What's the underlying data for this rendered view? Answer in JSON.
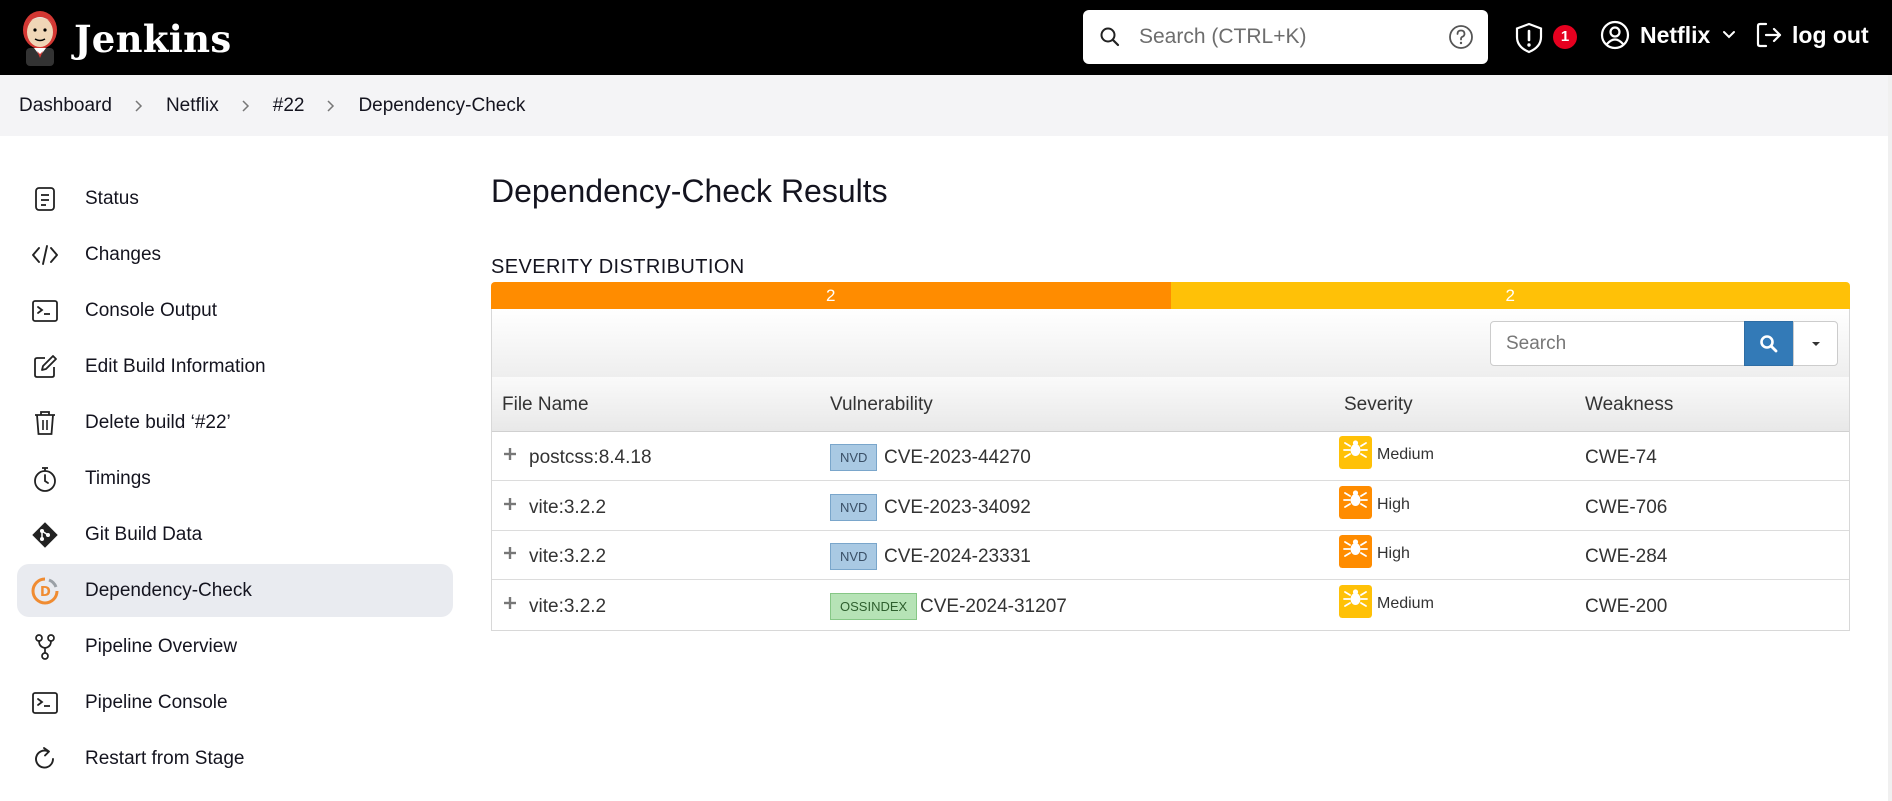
{
  "header": {
    "app_name": "Jenkins",
    "search_placeholder": "Search (CTRL+K)",
    "security_badge": "1",
    "user_name": "Netflix",
    "logout_label": "log out"
  },
  "breadcrumb": [
    "Dashboard",
    "Netflix",
    "#22",
    "Dependency-Check"
  ],
  "sidebar": {
    "items": [
      {
        "label": "Status",
        "icon": "document-icon"
      },
      {
        "label": "Changes",
        "icon": "code-icon"
      },
      {
        "label": "Console Output",
        "icon": "terminal-icon"
      },
      {
        "label": "Edit Build Information",
        "icon": "edit-icon"
      },
      {
        "label": "Delete build ‘#22’",
        "icon": "trash-icon"
      },
      {
        "label": "Timings",
        "icon": "stopwatch-icon"
      },
      {
        "label": "Git Build Data",
        "icon": "git-icon"
      },
      {
        "label": "Dependency-Check",
        "icon": "dependency-check-icon",
        "active": true
      },
      {
        "label": "Pipeline Overview",
        "icon": "pipeline-icon"
      },
      {
        "label": "Pipeline Console",
        "icon": "terminal-icon"
      },
      {
        "label": "Restart from Stage",
        "icon": "restart-icon"
      }
    ]
  },
  "main": {
    "title": "Dependency-Check Results",
    "severity_title": "SEVERITY DISTRIBUTION",
    "severity_distribution": [
      {
        "label": "2",
        "value": 2,
        "color": "#ff8c00"
      },
      {
        "label": "2",
        "value": 2,
        "color": "#ffc107"
      }
    ],
    "table": {
      "search_placeholder": "Search",
      "columns": [
        "File Name",
        "Vulnerability",
        "Severity",
        "Weakness"
      ],
      "rows": [
        {
          "file": "postcss:8.4.18",
          "source": "NVD",
          "cve": "CVE-2023-44270",
          "severity": "Medium",
          "severity_color": "#ffc107",
          "weakness": "CWE-74"
        },
        {
          "file": "vite:3.2.2",
          "source": "NVD",
          "cve": "CVE-2023-34092",
          "severity": "High",
          "severity_color": "#ff8c00",
          "weakness": "CWE-706"
        },
        {
          "file": "vite:3.2.2",
          "source": "NVD",
          "cve": "CVE-2024-23331",
          "severity": "High",
          "severity_color": "#ff8c00",
          "weakness": "CWE-284"
        },
        {
          "file": "vite:3.2.2",
          "source": "OSSINDEX",
          "cve": "CVE-2024-31207",
          "severity": "Medium",
          "severity_color": "#ffc107",
          "weakness": "CWE-200"
        }
      ]
    }
  }
}
